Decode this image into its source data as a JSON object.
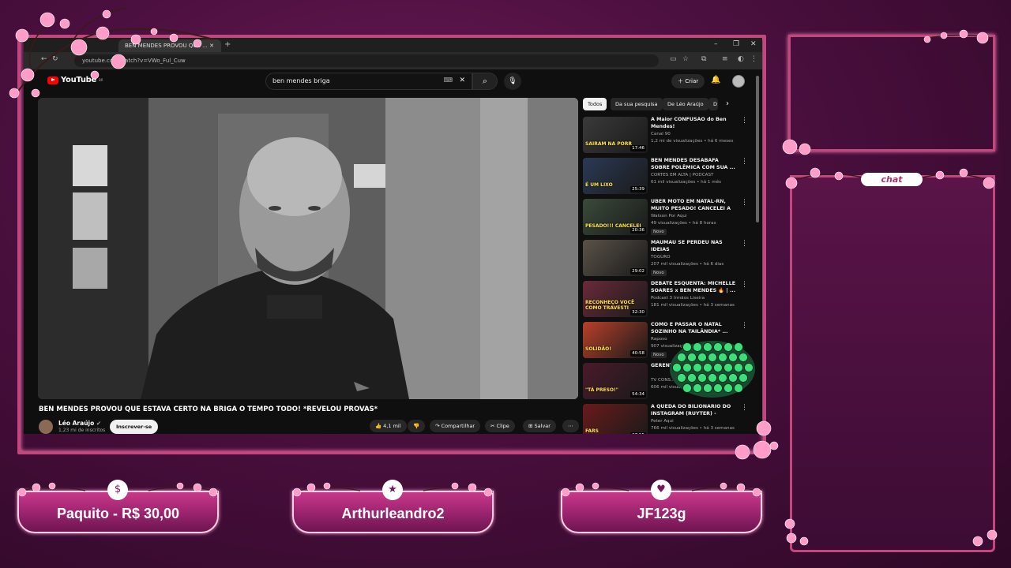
{
  "browser": {
    "tab_title": "BEN MENDES PROVOU QUE ...",
    "url": "youtube.com/watch?v=VWo_Ful_Cuw"
  },
  "youtube": {
    "logo_text": "YouTube",
    "logo_suffix": "BR",
    "search_query": "ben mendes briga",
    "create_label": "Criar",
    "video_title": "BEN MENDES PROVOU QUE ESTAVA CERTO NA BRIGA O TEMPO TODO! *REVELOU PROVAS*",
    "channel_name": "Léo Araújo",
    "channel_subs": "1,23 mi de inscritos",
    "subscribe_label": "Inscrever-se",
    "like_count": "4,1 mil",
    "share_label": "Compartilhar",
    "clip_label": "Clipe",
    "save_label": "Salvar"
  },
  "chips": [
    "Todos",
    "Da sua pesquisa",
    "De Léo Araújo",
    "D"
  ],
  "recommendations": [
    {
      "title": "A Maior CONFUSÃO do Ben Mendes!",
      "channel": "Canal 90",
      "meta": "1,2 mi de visualizações • há 6 meses",
      "badge": "",
      "duration": "17:46",
      "thumb_text": "SAIRAM NA PORR",
      "thumb_color": "#3a3a3a"
    },
    {
      "title": "BEN MENDES DESABAFA SOBRE POLÊMICA COM SUA ...",
      "channel": "CORTES EM ALTA | PODCAST",
      "meta": "61 mil visualizações • há 1 mês",
      "badge": "",
      "duration": "25:39",
      "thumb_text": "É UM LIXO",
      "thumb_color": "#2a3a55"
    },
    {
      "title": "UBER MOTO EM NATAL-RN, MUITO PESADO! CANCELEI A ...",
      "channel": "Watson Por Aqui",
      "meta": "49 visualizações • há 8 horas",
      "badge": "Novo",
      "duration": "20:36",
      "thumb_text": "PESADO!!! CANCELEI",
      "thumb_color": "#3a4a3a"
    },
    {
      "title": "MAUMAU SE PERDEU NAS IDEIAS",
      "channel": "TOGURO",
      "meta": "207 mil visualizações • há 6 dias",
      "badge": "Novo",
      "duration": "29:02",
      "thumb_text": "",
      "thumb_color": "#5a5248"
    },
    {
      "title": "DEBATE ESQUENTA: MICHELLE SOARES x BEN MENDES 🔥 | ...",
      "channel": "Podcast 3 Irmãos Liseira",
      "meta": "181 mil visualizações • há 3 semanas",
      "badge": "",
      "duration": "32:30",
      "thumb_text": "RECONHEÇO VOCÊ COMO TRAVESTI",
      "thumb_color": "#6a2a3a"
    },
    {
      "title": "COMO É PASSAR O NATAL SOZINHO NA TAILÂNDIA* ...",
      "channel": "Raposo",
      "meta": "907 visualizações",
      "badge": "Novo",
      "duration": "40:58",
      "thumb_text": "SOLIDÃO!",
      "thumb_color": "#b8402a"
    },
    {
      "title": "GERENTE ... DEBOCH...",
      "channel": "TV CONS...",
      "meta": "606 mil visua...",
      "badge": "",
      "duration": "54:34",
      "thumb_text": "\"TÁ PRESO!\"",
      "thumb_color": "#4a1a2a"
    },
    {
      "title": "A QUEDA DO BILIONÁRIO DO INSTAGRAM (RUYTER) - Peter...",
      "channel": "Peter Aqui",
      "meta": "766 mil visualizações • há 3 semanas",
      "badge": "",
      "duration": "37:55",
      "thumb_text": "FARS",
      "thumb_color": "#6a1a1a"
    }
  ],
  "overlay": {
    "chat_label": "chat",
    "alerts": [
      {
        "text": "Paquito - R$ 30,00",
        "icon": "dollar-icon",
        "glyph": "$"
      },
      {
        "text": "Arthurleandro2",
        "icon": "star-icon",
        "glyph": "★"
      },
      {
        "text": "JF123g",
        "icon": "heart-icon",
        "glyph": "♥"
      }
    ]
  },
  "colors": {
    "frame": "#c2477e",
    "bg": "#4a0f3e",
    "yt_red": "#ff0000",
    "emote_green": "#3be07a"
  }
}
